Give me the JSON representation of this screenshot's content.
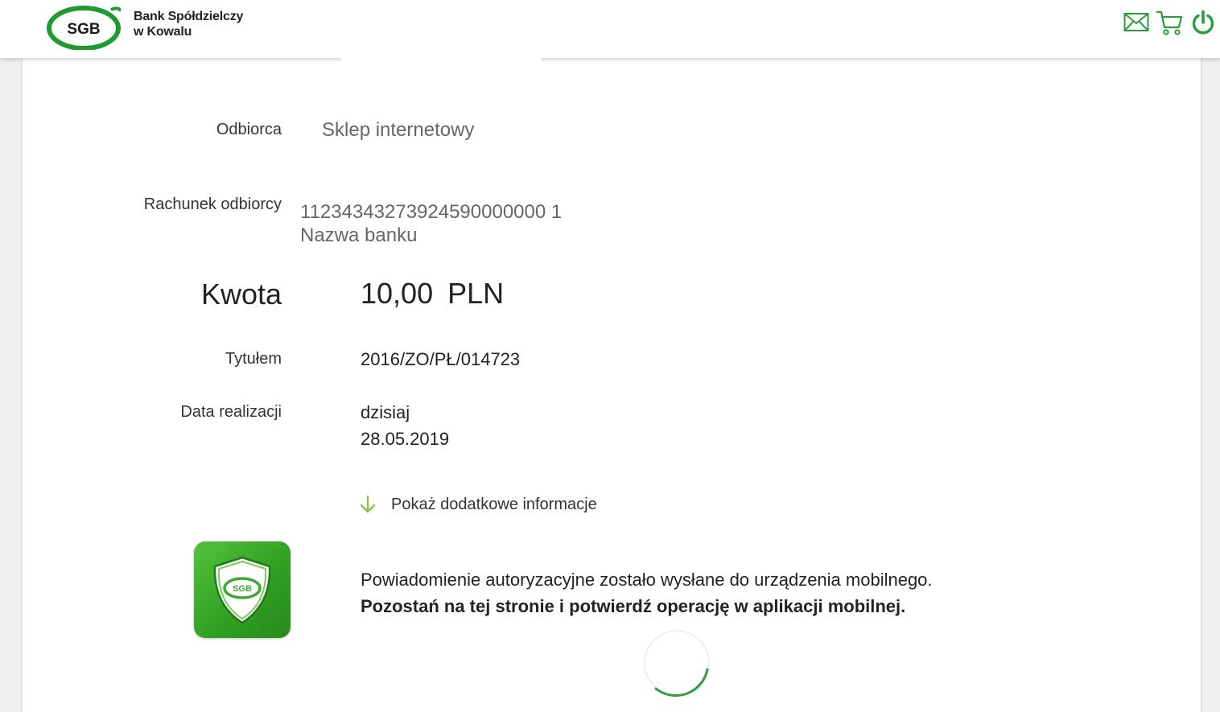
{
  "header": {
    "logo_text": "SGB",
    "bank_name_line1": "Bank Spółdzielczy",
    "bank_name_line2": "w Kowalu",
    "icons": [
      "mail-icon",
      "cart-icon",
      "power-icon"
    ]
  },
  "details": {
    "recipient_label": "Odbiorca",
    "recipient_value": "Sklep internetowy",
    "account_label": "Rachunek odbiorcy",
    "account_number": "11234343273924590000000 1",
    "bank_name": "Nazwa banku",
    "amount_label": "Kwota",
    "amount_value": "10,00",
    "amount_currency": "PLN",
    "title_label": "Tytułem",
    "title_value": "2016/ZO/PŁ/014723",
    "date_label": "Data realizacji",
    "date_value_line1": "dzisiaj",
    "date_value_line2": "28.05.2019"
  },
  "more_info": {
    "label": "Pokaż dodatkowe informacje",
    "icon": "arrow-down-icon"
  },
  "authorization": {
    "app_logo_text": "SGB",
    "message_line1": "Powiadomienie autoryzacyjne zostało wysłane do urządzenia mobilnego.",
    "message_line2": "Pozostań na tej stronie i potwierdź operację w aplikacji mobilnej."
  },
  "colors": {
    "brand_green": "#1e9a2e",
    "icon_green": "#2a9d3a",
    "arrow_green": "#8bc34a",
    "spinner_green": "#2e9e3e"
  }
}
